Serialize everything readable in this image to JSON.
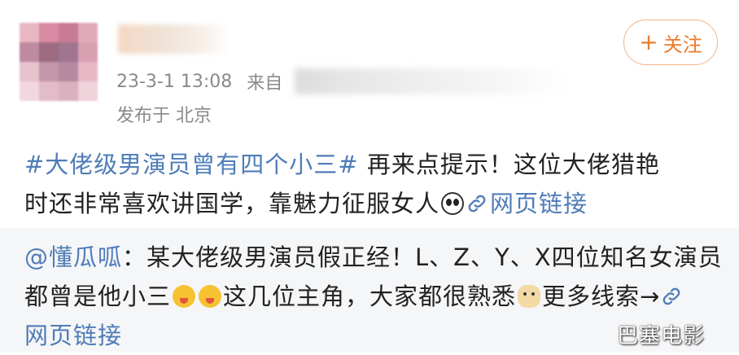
{
  "post": {
    "time": "23-3-1 13:08",
    "from_label": "来自",
    "location": "发布于 北京",
    "follow": {
      "plus": "+",
      "label": "关注"
    },
    "topic": "#大佬级男演员曾有四个小三#",
    "text_line1_rest": " 再来点提示！这位大佬猎艳",
    "text_line2": "时还非常喜欢讲国学，靠魅力征服女人",
    "link_label": "网页链接"
  },
  "repost": {
    "mention": "@懂瓜呱",
    "line1_rest": "：某大佬级男演员假正经！L、Z、Y、X四位知名女演员",
    "line2_a": "都曾是他小三",
    "line2_b": "这几位主角，大家都很熟悉",
    "line2_c": "更多线索→",
    "link_label": "网页链接"
  },
  "watermark": "巴塞电影",
  "colors": {
    "link": "#4f7cb8",
    "follow": "#ec7b2a",
    "repost_bg": "#f5f6f8"
  },
  "icons": [
    "panda-emoji",
    "link-icon",
    "yum-emoji",
    "doge-emoji"
  ]
}
